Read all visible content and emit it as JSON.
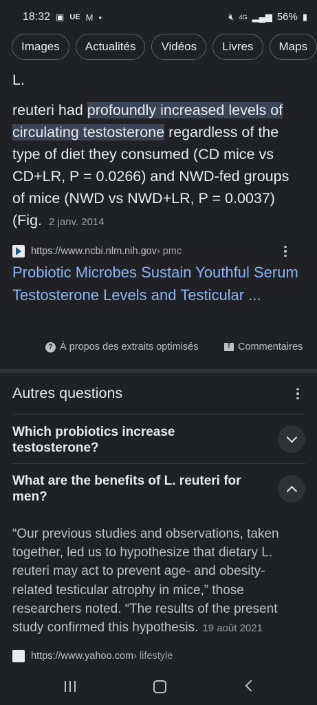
{
  "status": {
    "time": "18:32",
    "left_icons": [
      "image-icon",
      "ue-badge",
      "gmail-icon",
      "dot"
    ],
    "ue": "UE",
    "battery": "56%",
    "network": "4G"
  },
  "chips": [
    "Images",
    "Actualités",
    "Vidéos",
    "Livres",
    "Maps"
  ],
  "snippet": {
    "lead": "L.",
    "part1": "reuteri had ",
    "highlight": "profoundly increased levels of circulating testosterone",
    "part2": " regardless of the type of diet they consumed (CD mice vs CD+LR, P = 0.0266) and NWD-fed groups of mice (NWD vs NWD+LR, P = 0.0037) (Fig. ",
    "date": "2 janv. 2014"
  },
  "result": {
    "url": "https://www.ncbi.nlm.nih.gov",
    "path": " › pmc",
    "title": "Probiotic Microbes Sustain Youthful Serum Testosterone Levels and Testicular ..."
  },
  "feedback": {
    "about": "À propos des extraits optimisés",
    "comments": "Commentaires"
  },
  "paa": {
    "title": "Autres questions",
    "questions": [
      "Which probiotics increase testosterone?",
      "What are the benefits of L. reuteri for men?"
    ],
    "answer": "“Our previous studies and observations, taken together, led us to hypothesize that dietary L. reuteri may act to prevent age- and obesity-related testicular atrophy in mice,” those researchers noted. “The results of the present study confirmed this hypothesis.",
    "answer_date": "19 août 2021",
    "source_url": "https://www.yahoo.com",
    "source_path": " › lifestyle"
  },
  "colors": {
    "background": "#202124",
    "link": "#8ab4f8",
    "highlight": "#394457"
  }
}
